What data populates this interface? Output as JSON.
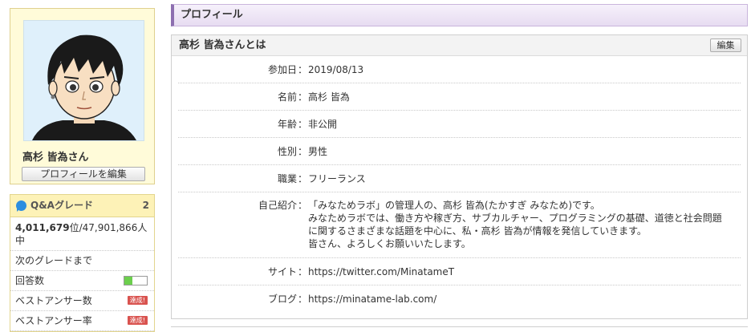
{
  "user": {
    "name": "高杉 皆為さん",
    "edit_profile_label": "プロフィールを編集"
  },
  "grade": {
    "title": "Q&Aグレード",
    "level": "2",
    "rank_value": "4,011,679",
    "rank_suffix": "位/47,901,866人中",
    "next_grade_label": "次のグレードまで",
    "rows": [
      {
        "label": "回答数",
        "type": "meter",
        "progress": 0.35
      },
      {
        "label": "ベストアンサー数",
        "type": "badge",
        "badge": "達成!"
      },
      {
        "label": "ベストアンサー率",
        "type": "badge",
        "badge": "達成!"
      }
    ]
  },
  "section_title": "プロフィール",
  "panel": {
    "title": "高杉 皆為さんとは",
    "edit_label": "編集"
  },
  "profile_rows": [
    {
      "label": "参加日",
      "value": "2019/08/13"
    },
    {
      "label": "名前",
      "value": "高杉 皆為"
    },
    {
      "label": "年齢",
      "value": "非公開"
    },
    {
      "label": "性別",
      "value": "男性"
    },
    {
      "label": "職業",
      "value": "フリーランス"
    },
    {
      "label": "自己紹介",
      "lines": [
        "「みなためラボ」の管理人の、高杉 皆為(たかすぎ みなため)です。",
        "みなためラボでは、働き方や稼ぎ方、サブカルチャー、プログラミングの基礎、道徳と社会問題",
        "に関するさまざまな話題を中心に、私・高杉 皆為が情報を発信していきます。",
        "皆さん、よろしくお願いいたします。"
      ]
    },
    {
      "label": "サイト",
      "value": "https://twitter.com/MinatameT",
      "link": true
    },
    {
      "label": "ブログ",
      "value": "https://minatame-lab.com/",
      "link": true
    }
  ],
  "colon": "：",
  "colors": {
    "profile_card_bg": "#fffbd9",
    "section_accent": "#8d6fb0",
    "meter_fill": "#6ccf4d",
    "badge_red": "#d9534f",
    "qa_icon": "#2c8ee0"
  }
}
